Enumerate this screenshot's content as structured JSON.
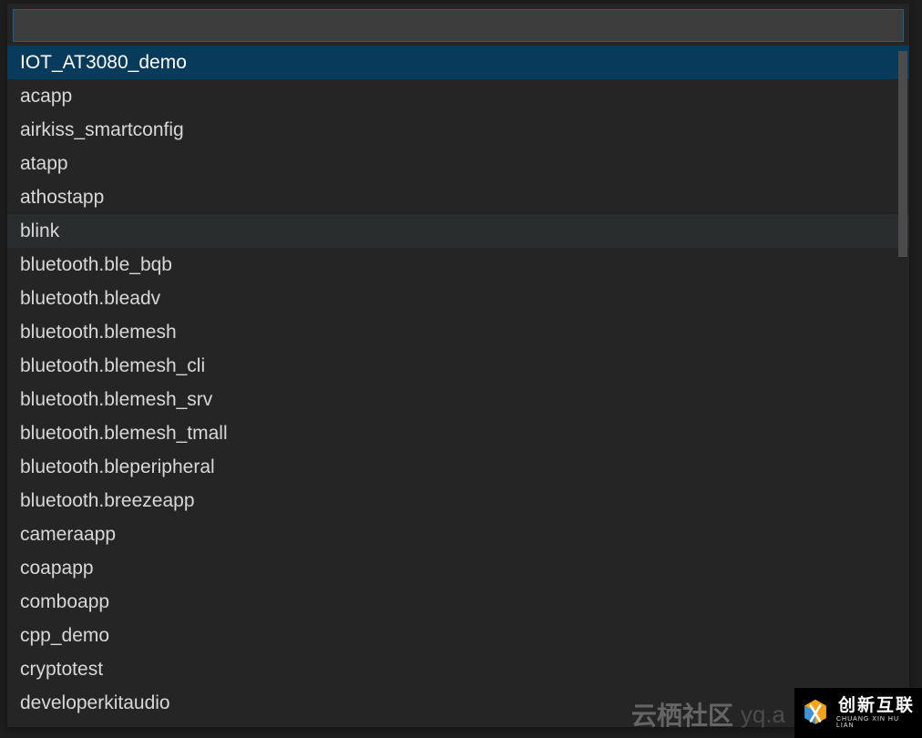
{
  "search": {
    "value": "",
    "placeholder": ""
  },
  "list": {
    "items": [
      {
        "label": "IOT_AT3080_demo",
        "selected": true,
        "hovered": false
      },
      {
        "label": "acapp",
        "selected": false,
        "hovered": false
      },
      {
        "label": "airkiss_smartconfig",
        "selected": false,
        "hovered": false
      },
      {
        "label": "atapp",
        "selected": false,
        "hovered": false
      },
      {
        "label": "athostapp",
        "selected": false,
        "hovered": false
      },
      {
        "label": "blink",
        "selected": false,
        "hovered": true
      },
      {
        "label": "bluetooth.ble_bqb",
        "selected": false,
        "hovered": false
      },
      {
        "label": "bluetooth.bleadv",
        "selected": false,
        "hovered": false
      },
      {
        "label": "bluetooth.blemesh",
        "selected": false,
        "hovered": false
      },
      {
        "label": "bluetooth.blemesh_cli",
        "selected": false,
        "hovered": false
      },
      {
        "label": "bluetooth.blemesh_srv",
        "selected": false,
        "hovered": false
      },
      {
        "label": "bluetooth.blemesh_tmall",
        "selected": false,
        "hovered": false
      },
      {
        "label": "bluetooth.bleperipheral",
        "selected": false,
        "hovered": false
      },
      {
        "label": "bluetooth.breezeapp",
        "selected": false,
        "hovered": false
      },
      {
        "label": "cameraapp",
        "selected": false,
        "hovered": false
      },
      {
        "label": "coapapp",
        "selected": false,
        "hovered": false
      },
      {
        "label": "comboapp",
        "selected": false,
        "hovered": false
      },
      {
        "label": "cpp_demo",
        "selected": false,
        "hovered": false
      },
      {
        "label": "cryptotest",
        "selected": false,
        "hovered": false
      },
      {
        "label": "developerkitaudio",
        "selected": false,
        "hovered": false
      }
    ]
  },
  "watermark": {
    "brand": "云栖社区",
    "suffix": "yq.a"
  },
  "logo": {
    "cn": "创新互联",
    "en": "CHUANG XIN HU LIAN"
  },
  "colors": {
    "panel_bg": "#252526",
    "input_bg": "#3c3c3c",
    "input_border": "#0e639c",
    "item_selected_bg": "#083a5c",
    "item_hover_bg": "#2a2d2e",
    "text": "#d8d8d8",
    "scrollbar": "#4b4b4b",
    "logo_orange": "#f6a31a",
    "logo_blue": "#3a96d8"
  }
}
